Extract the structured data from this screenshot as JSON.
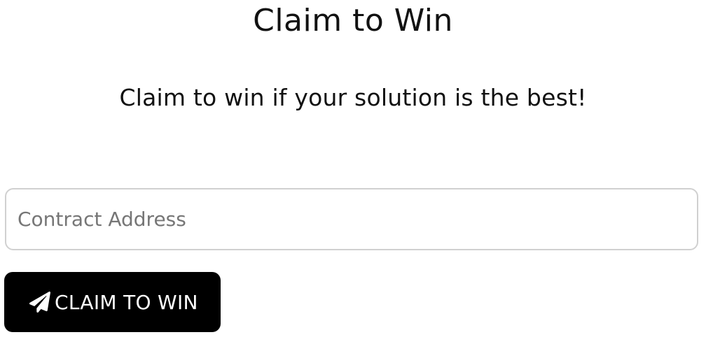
{
  "header": {
    "title": "Claim to Win",
    "subtitle": "Claim to win if your solution is the best!"
  },
  "form": {
    "address_input": {
      "value": "",
      "placeholder": "Contract Address"
    },
    "submit": {
      "label": "CLAIM TO WIN",
      "icon": "paper-plane-icon"
    }
  },
  "colors": {
    "background": "#ffffff",
    "text": "#111111",
    "button_background": "#000000",
    "button_text": "#ffffff",
    "input_border": "#d0d0d0",
    "placeholder": "#767676"
  }
}
